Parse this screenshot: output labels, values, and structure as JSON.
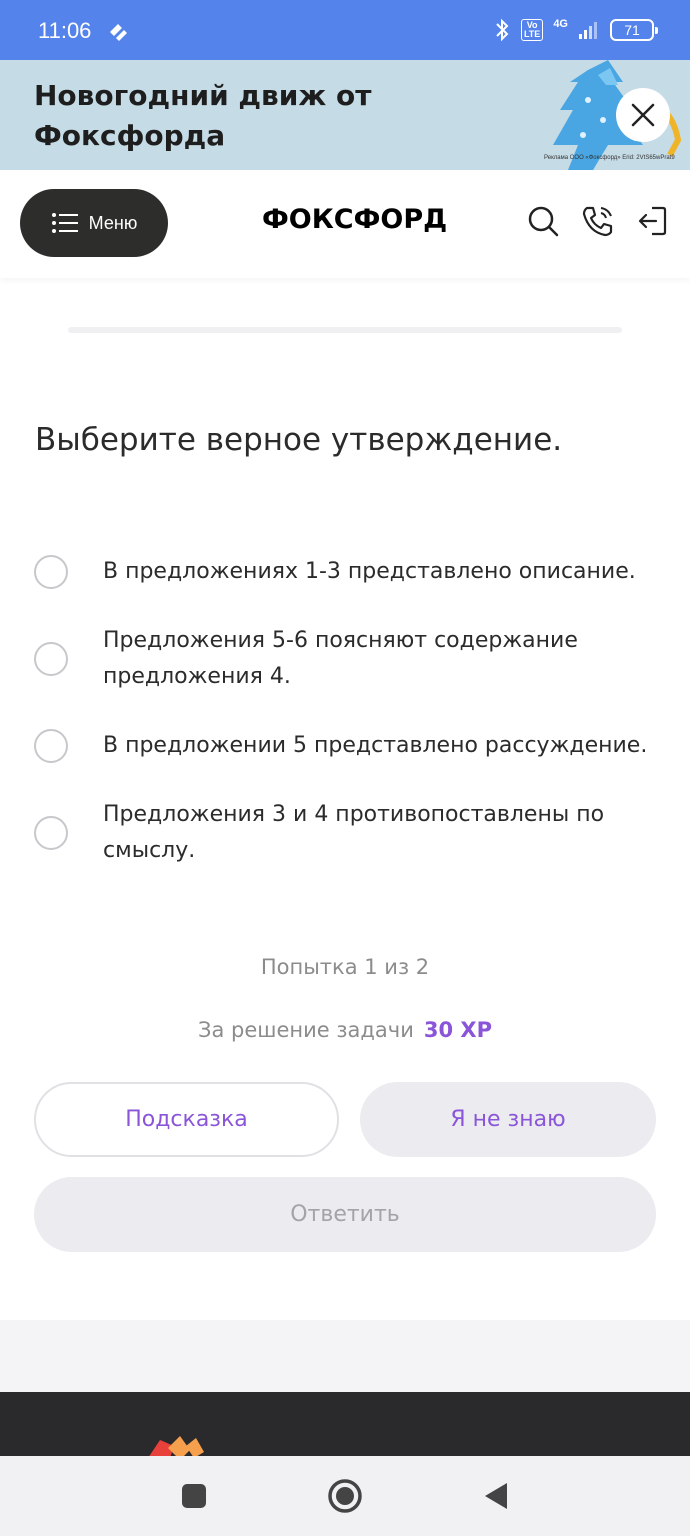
{
  "status_bar": {
    "time": "11:06",
    "network_type": "4G",
    "volte": "Vo LTE",
    "battery": "71"
  },
  "promo": {
    "title": "Новогодний движ от Фоксфорда",
    "legal": "Реклама ООО «Фоксфорд» Erid: 2VtS65wPrat9"
  },
  "header": {
    "menu_label": "Меню",
    "logo": "ФОКСФОРД"
  },
  "task": {
    "question": "Выберите верное утверждение.",
    "options": [
      "В предложениях 1-3 представлено описание.",
      "Предложения 5-6 поясняют содержание предложения 4.",
      "В предложении 5 представлено рассуждение.",
      "Предложения 3 и 4 противопоставлены по смыслу."
    ],
    "attempt": "Попытка 1 из 2",
    "reward_label": "За решение задачи",
    "reward_xp": "30 XP"
  },
  "buttons": {
    "hint": "Подсказка",
    "dont_know": "Я не знаю",
    "answer": "Ответить"
  },
  "colors": {
    "status_bar": "#5583ec",
    "promo_bg": "#c5dbe6",
    "accent_purple": "#8a55d8",
    "menu_button": "#2d2d2b",
    "footer_dark": "#2a2a2c"
  }
}
